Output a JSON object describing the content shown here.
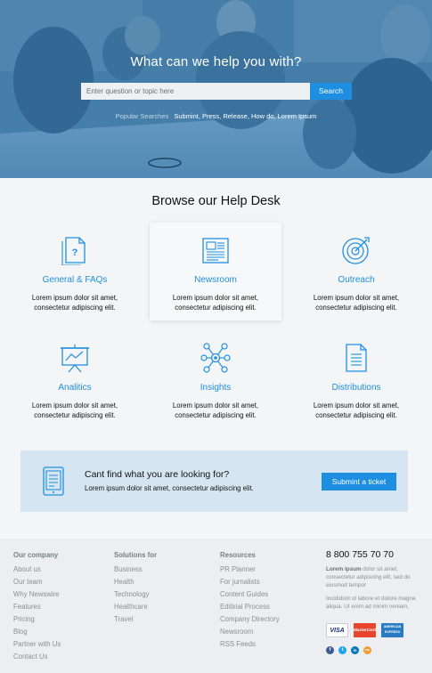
{
  "hero": {
    "title": "What can we help you with?",
    "search_placeholder": "Enter question or topic here",
    "search_button": "Search",
    "popular_label": "Popular Searches",
    "popular_terms": "Submint, Press, Release, How do, Lorem Ipsum"
  },
  "browse": {
    "title": "Browse our Help Desk",
    "cards": [
      {
        "title": "General & FAQs",
        "desc": "Lorem ipsum dolor sit amet, consectetur adipiscing elit.",
        "icon": "document-question-icon"
      },
      {
        "title": "Newsroom",
        "desc": "Lorem ipsum dolor sit amet, consectetur adipiscing elit.",
        "icon": "newspaper-icon"
      },
      {
        "title": "Outreach",
        "desc": "Lorem ipsum dolor sit amet, consectetur adipiscing elit.",
        "icon": "target-icon"
      },
      {
        "title": "Analitics",
        "desc": "Lorem ipsum dolor sit amet, consectetur adipiscing elit.",
        "icon": "presentation-chart-icon"
      },
      {
        "title": "Insights",
        "desc": "Lorem ipsum dolor sit amet, consectetur adipiscing elit.",
        "icon": "network-icon"
      },
      {
        "title": "Distributions",
        "desc": "Lorem ipsum dolor sit amet, consectetur adipiscing elit.",
        "icon": "document-lines-icon"
      }
    ]
  },
  "cta": {
    "title": "Cant find what you are looking for?",
    "subtitle": "Lorem ipsum dolor sit amet, consectetur adipiscing elit.",
    "button": "Submint a ticket"
  },
  "footer": {
    "columns": [
      {
        "heading": "Our company",
        "items": [
          "About us",
          "Our team",
          "Why Newswire",
          "Features",
          "Pricing",
          "Blog",
          "Partner with Us",
          "Contact Us"
        ]
      },
      {
        "heading": "Solutions for",
        "items": [
          "Business",
          "Health",
          "Technology",
          "Healthcare",
          "Travel"
        ]
      },
      {
        "heading": "Resources",
        "items": [
          "PR Planner",
          "For jurnalists",
          "Content Guides",
          "Editirial Process",
          "Company Directory",
          "Newsroom",
          "RSS Feeds"
        ]
      }
    ],
    "phone": "8 800 755 70 70",
    "para1_bold": "Lorem ipsum",
    "para1_rest": " dolor sit amet, consectetur adipiscing elit, sed do eiusmod tempor",
    "para2": "Incididunt ut labore et dolore magna aliqua. Ut enim ad minim veniam,",
    "payment_cards": [
      "VISA",
      "MasterCard",
      "AMERICAN EXPRESS"
    ],
    "socials": [
      "f",
      "t",
      "in",
      "rss"
    ]
  },
  "colors": {
    "accent": "#1e8fe0",
    "cta_bg": "#d5e6f2",
    "footer_bg": "#eceef1"
  }
}
